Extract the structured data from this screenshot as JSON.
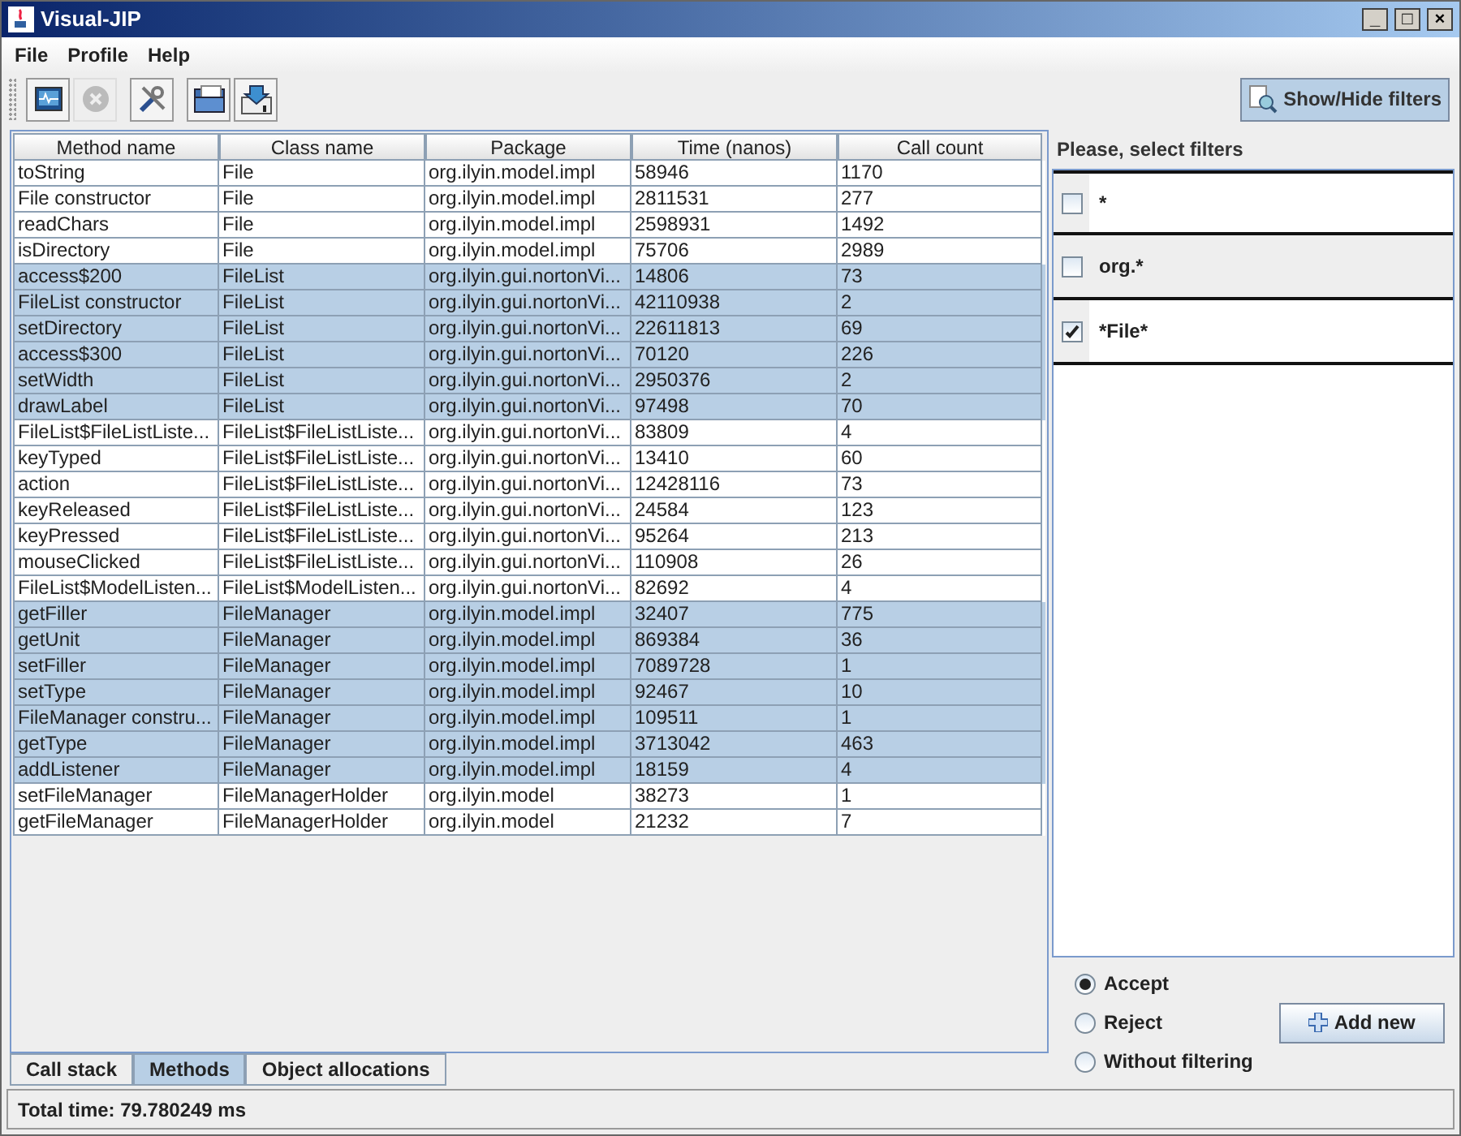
{
  "window": {
    "title": "Visual-JIP",
    "controls": [
      "_",
      "□",
      "×"
    ]
  },
  "menu": [
    "File",
    "Profile",
    "Help"
  ],
  "toolbar": [
    {
      "kind": "monitor",
      "disabled": false
    },
    {
      "kind": "stop",
      "disabled": true
    },
    {
      "kind": "tools",
      "disabled": false
    },
    {
      "kind": "open",
      "disabled": false
    },
    {
      "kind": "save",
      "disabled": false
    }
  ],
  "filters_toggle": {
    "label": "Show/Hide filters"
  },
  "table": {
    "columns": [
      "Method name",
      "Class name",
      "Package",
      "Time (nanos)",
      "Call count"
    ],
    "rows": [
      {
        "cells": [
          "toString",
          "File",
          "org.ilyin.model.impl",
          "58946",
          "1170"
        ],
        "selected": false
      },
      {
        "cells": [
          "File constructor",
          "File",
          "org.ilyin.model.impl",
          "2811531",
          "277"
        ],
        "selected": false
      },
      {
        "cells": [
          "readChars",
          "File",
          "org.ilyin.model.impl",
          "2598931",
          "1492"
        ],
        "selected": false
      },
      {
        "cells": [
          "isDirectory",
          "File",
          "org.ilyin.model.impl",
          "75706",
          "2989"
        ],
        "selected": false
      },
      {
        "cells": [
          "access$200",
          "FileList",
          "org.ilyin.gui.nortonVi...",
          "14806",
          "73"
        ],
        "selected": true
      },
      {
        "cells": [
          "FileList constructor",
          "FileList",
          "org.ilyin.gui.nortonVi...",
          "42110938",
          "2"
        ],
        "selected": true
      },
      {
        "cells": [
          "setDirectory",
          "FileList",
          "org.ilyin.gui.nortonVi...",
          "22611813",
          "69"
        ],
        "selected": true
      },
      {
        "cells": [
          "access$300",
          "FileList",
          "org.ilyin.gui.nortonVi...",
          "70120",
          "226"
        ],
        "selected": true
      },
      {
        "cells": [
          "setWidth",
          "FileList",
          "org.ilyin.gui.nortonVi...",
          "2950376",
          "2"
        ],
        "selected": true
      },
      {
        "cells": [
          "drawLabel",
          "FileList",
          "org.ilyin.gui.nortonVi...",
          "97498",
          "70"
        ],
        "selected": true
      },
      {
        "cells": [
          "FileList$FileListListe...",
          "FileList$FileListListe...",
          "org.ilyin.gui.nortonVi...",
          "83809",
          "4"
        ],
        "selected": false
      },
      {
        "cells": [
          "keyTyped",
          "FileList$FileListListe...",
          "org.ilyin.gui.nortonVi...",
          "13410",
          "60"
        ],
        "selected": false
      },
      {
        "cells": [
          "action",
          "FileList$FileListListe...",
          "org.ilyin.gui.nortonVi...",
          "12428116",
          "73"
        ],
        "selected": false
      },
      {
        "cells": [
          "keyReleased",
          "FileList$FileListListe...",
          "org.ilyin.gui.nortonVi...",
          "24584",
          "123"
        ],
        "selected": false
      },
      {
        "cells": [
          "keyPressed",
          "FileList$FileListListe...",
          "org.ilyin.gui.nortonVi...",
          "95264",
          "213"
        ],
        "selected": false
      },
      {
        "cells": [
          "mouseClicked",
          "FileList$FileListListe...",
          "org.ilyin.gui.nortonVi...",
          "110908",
          "26"
        ],
        "selected": false
      },
      {
        "cells": [
          "FileList$ModelListen...",
          "FileList$ModelListen...",
          "org.ilyin.gui.nortonVi...",
          "82692",
          "4"
        ],
        "selected": false
      },
      {
        "cells": [
          "getFiller",
          "FileManager",
          "org.ilyin.model.impl",
          "32407",
          "775"
        ],
        "selected": true
      },
      {
        "cells": [
          "getUnit",
          "FileManager",
          "org.ilyin.model.impl",
          "869384",
          "36"
        ],
        "selected": true
      },
      {
        "cells": [
          "setFiller",
          "FileManager",
          "org.ilyin.model.impl",
          "7089728",
          "1"
        ],
        "selected": true
      },
      {
        "cells": [
          "setType",
          "FileManager",
          "org.ilyin.model.impl",
          "92467",
          "10"
        ],
        "selected": true
      },
      {
        "cells": [
          "FileManager constru...",
          "FileManager",
          "org.ilyin.model.impl",
          "109511",
          "1"
        ],
        "selected": true
      },
      {
        "cells": [
          "getType",
          "FileManager",
          "org.ilyin.model.impl",
          "3713042",
          "463"
        ],
        "selected": true
      },
      {
        "cells": [
          "addListener",
          "FileManager",
          "org.ilyin.model.impl",
          "18159",
          "4"
        ],
        "selected": true
      },
      {
        "cells": [
          "setFileManager",
          "FileManagerHolder",
          "org.ilyin.model",
          "38273",
          "1"
        ],
        "selected": false
      },
      {
        "cells": [
          "getFileManager",
          "FileManagerHolder",
          "org.ilyin.model",
          "21232",
          "7"
        ],
        "selected": false
      }
    ]
  },
  "filters": {
    "title": "Please, select filters",
    "items": [
      {
        "pattern": "*",
        "checked": false
      },
      {
        "pattern": "org.*",
        "checked": false
      },
      {
        "pattern": "*File*",
        "checked": true
      }
    ],
    "modes": [
      {
        "label": "Accept",
        "selected": true
      },
      {
        "label": "Reject",
        "selected": false
      },
      {
        "label": "Without filtering",
        "selected": false
      }
    ],
    "add_button": "Add new"
  },
  "tabs": [
    {
      "label": "Call stack",
      "selected": false
    },
    {
      "label": "Methods",
      "selected": true
    },
    {
      "label": "Object allocations",
      "selected": false
    }
  ],
  "status_bar": "Total time: 79.780249 ms"
}
